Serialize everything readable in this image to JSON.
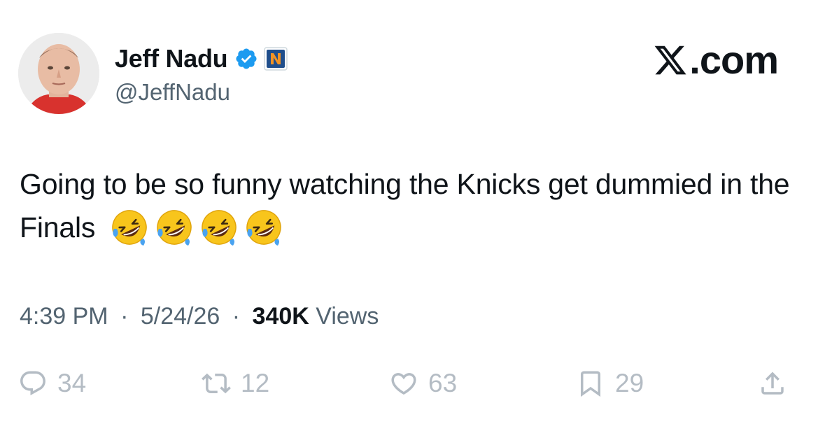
{
  "author": {
    "display_name": "Jeff Nadu",
    "handle": "@JeffNadu",
    "verified_icon": "verified-check-icon",
    "affiliate_icon": "affiliate-badge-icon"
  },
  "brand": {
    "text": ".com",
    "logo_icon": "x-logo-icon"
  },
  "tweet": {
    "text": "Going to be so funny watching the Knicks get dummied in the Finals",
    "emoji": [
      "rolling-on-floor-laughing-emoji",
      "rolling-on-floor-laughing-emoji",
      "rolling-on-floor-laughing-emoji",
      "rolling-on-floor-laughing-emoji"
    ]
  },
  "meta": {
    "time": "4:39 PM",
    "date": "5/24/26",
    "separator": "·",
    "views_count": "340K",
    "views_label": "Views"
  },
  "actions": {
    "reply_count": "34",
    "retweet_count": "12",
    "like_count": "63",
    "bookmark_count": "29"
  },
  "colors": {
    "text_primary": "#0f1419",
    "text_secondary": "#536471",
    "action_gray": "#b4bcc4",
    "verified_blue": "#1d9bf0"
  }
}
